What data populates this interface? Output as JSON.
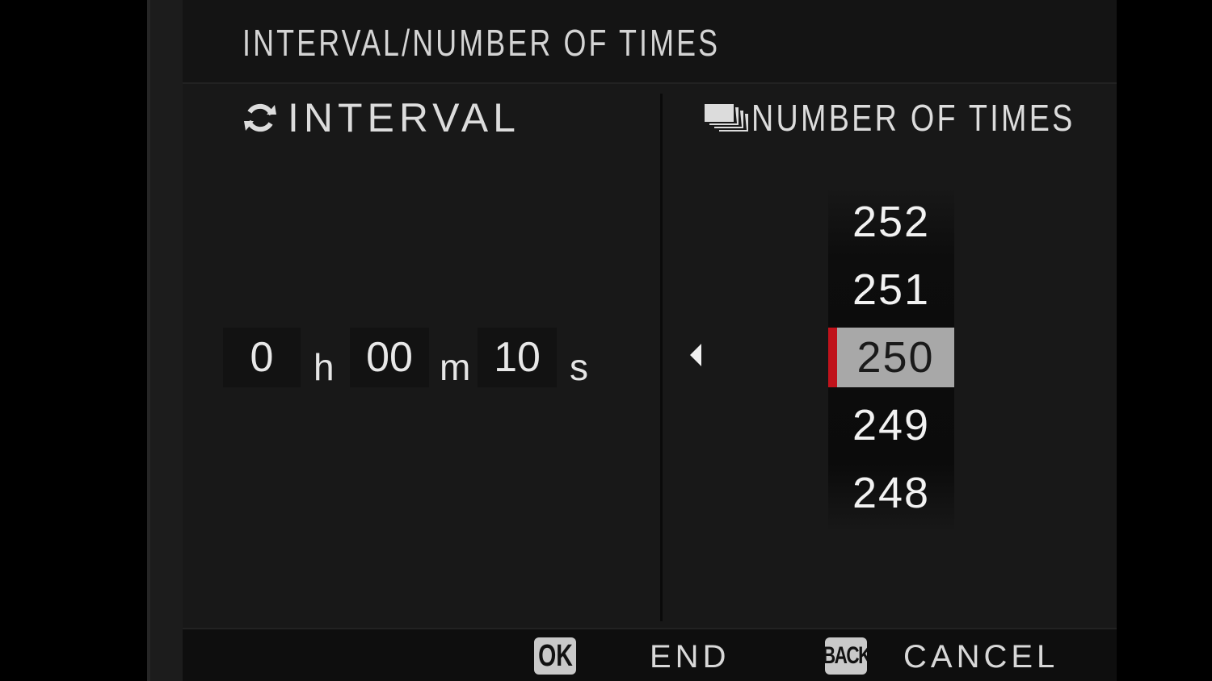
{
  "header": {
    "title": "INTERVAL/NUMBER OF TIMES"
  },
  "interval": {
    "label": "INTERVAL",
    "icon": "refresh-icon",
    "hours": "0",
    "hours_unit": "h",
    "minutes": "00",
    "minutes_unit": "m",
    "seconds": "10",
    "seconds_unit": "s"
  },
  "times": {
    "label": "NUMBER OF TIMES",
    "icon": "burst-icon",
    "options": [
      "252",
      "251",
      "250",
      "249",
      "248"
    ],
    "selected": "250"
  },
  "footer": {
    "ok_key": "OK",
    "ok_label": "END",
    "back_key": "BACK",
    "back_label": "CANCEL"
  },
  "colors": {
    "accent": "#c0121b",
    "selected_bg": "#a8a8a8",
    "panel_bg": "#181818"
  }
}
